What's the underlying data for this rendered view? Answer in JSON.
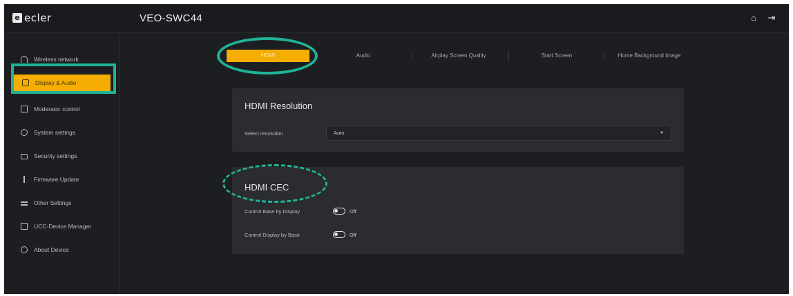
{
  "header": {
    "logo_text": "ecler",
    "device_name": "VEO-SWC44",
    "icons": [
      "home-icon",
      "logout-icon"
    ]
  },
  "sidebar": {
    "items": [
      {
        "label": "Wireless network",
        "icon": "wifi-icon"
      },
      {
        "label": "Display & Audio",
        "icon": "display-icon",
        "active": true
      },
      {
        "label": "Moderator control",
        "icon": "square-icon"
      },
      {
        "label": "System settings",
        "icon": "gear-icon"
      },
      {
        "label": "Security settings",
        "icon": "lock-icon"
      },
      {
        "label": "Firmware Update",
        "icon": "upload-icon"
      },
      {
        "label": "Other Settings",
        "icon": "sliders-icon"
      },
      {
        "label": "UCC-Device Manager",
        "icon": "device-icon"
      },
      {
        "label": "About Device",
        "icon": "info-icon"
      }
    ]
  },
  "tabs": [
    {
      "label": "HDMI",
      "active": true
    },
    {
      "label": "Audio"
    },
    {
      "label": "Airplay Screen Quality"
    },
    {
      "label": "Start Screen"
    },
    {
      "label": "Home Background Image"
    }
  ],
  "hdmi_resolution": {
    "title": "HDMI Resolution",
    "select_label": "Select resolution",
    "select_value": "Auto"
  },
  "hdmi_cec": {
    "title": "HDMI CEC",
    "rows": [
      {
        "label": "Control Base by Display",
        "state": "Off"
      },
      {
        "label": "Control Display by Base",
        "state": "Off"
      }
    ]
  },
  "colors": {
    "accent": "#f4ad00",
    "highlight": "#1fb396",
    "background": "#1d1e21",
    "panel": "#2b2c30"
  }
}
